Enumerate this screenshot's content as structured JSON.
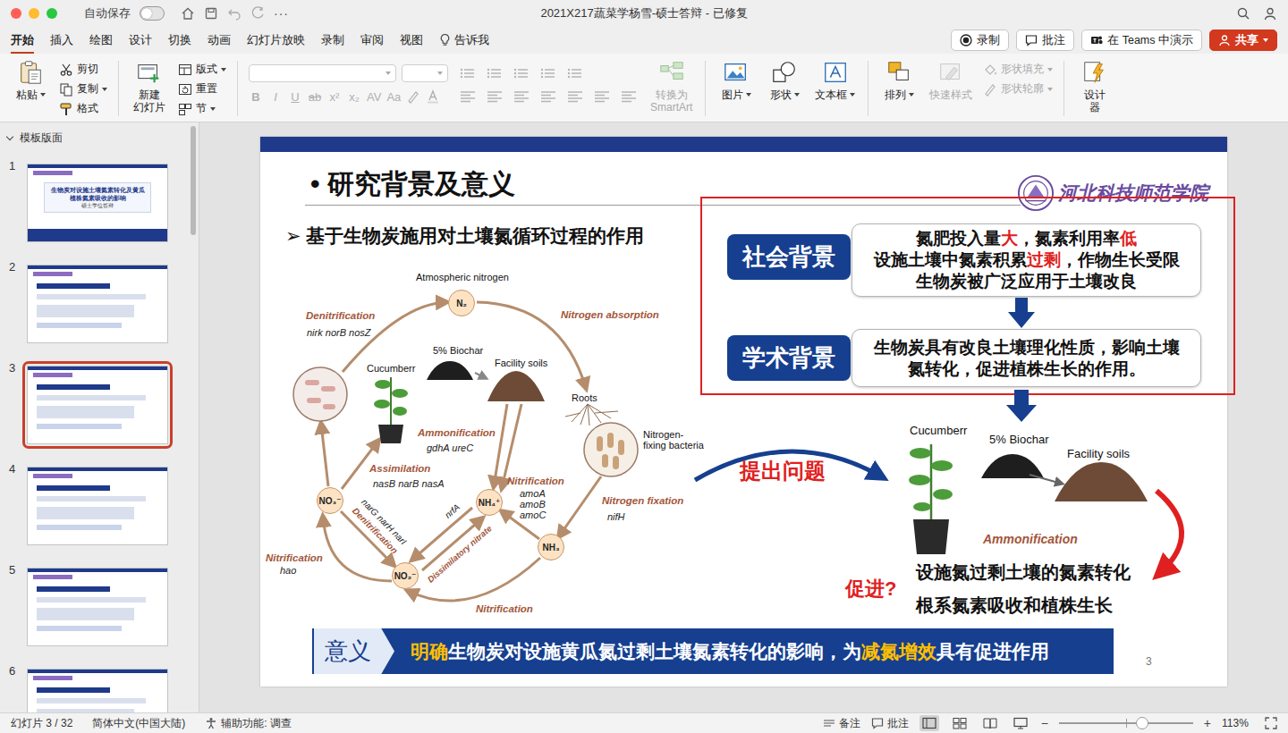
{
  "window": {
    "title": "2021X217蔬菜学杨雪-硕士答辩 - 已修复",
    "autosave": {
      "label": "自动保存",
      "on": false
    },
    "more": "···"
  },
  "tabs": [
    {
      "label": "开始",
      "selected": true
    },
    {
      "label": "插入",
      "selected": false
    },
    {
      "label": "绘图",
      "selected": false
    },
    {
      "label": "设计",
      "selected": false
    },
    {
      "label": "切换",
      "selected": false
    },
    {
      "label": "动画",
      "selected": false
    },
    {
      "label": "幻灯片放映",
      "selected": false
    },
    {
      "label": "录制",
      "selected": false
    },
    {
      "label": "审阅",
      "selected": false
    },
    {
      "label": "视图",
      "selected": false
    }
  ],
  "tell_me": "告诉我",
  "actions": [
    {
      "label": "录制",
      "kind": "record"
    },
    {
      "label": "批注",
      "kind": "comment"
    },
    {
      "label": "在 Teams 中演示",
      "kind": "teams"
    },
    {
      "label": "共享",
      "kind": "share"
    }
  ],
  "ribbon": {
    "paste": "粘贴",
    "clipboard": [
      {
        "label": "剪切",
        "kind": "cut"
      },
      {
        "label": "复制",
        "kind": "copy"
      },
      {
        "label": "格式",
        "kind": "brush"
      }
    ],
    "new_slide": [
      "新建",
      "幻灯片"
    ],
    "slide_tools": [
      {
        "label": "版式",
        "kind": "layout",
        "dropdown": true
      },
      {
        "label": "重置",
        "kind": "reset",
        "dropdown": false
      },
      {
        "label": "节",
        "kind": "section",
        "dropdown": true
      }
    ],
    "format_buttons": [
      {
        "label": "B",
        "disabled": true
      },
      {
        "label": "I",
        "disabled": true
      },
      {
        "label": "U",
        "disabled": true
      },
      {
        "label": "ab",
        "disabled": true
      },
      {
        "label": "x²",
        "disabled": true
      },
      {
        "label": "x₂",
        "disabled": true
      },
      {
        "label": "AV",
        "disabled": true
      },
      {
        "label": "Aa",
        "disabled": true
      }
    ],
    "smartart": {
      "lines": [
        "转换为",
        "SmartArt"
      ],
      "disabled": true
    },
    "insert": [
      {
        "label": "图片",
        "kind": "picture"
      },
      {
        "label": "形状",
        "kind": "shape"
      },
      {
        "label": "文本框",
        "kind": "textbox"
      }
    ],
    "arrange": [
      {
        "label": "排列",
        "kind": "arrange",
        "disabled": false
      },
      {
        "label": "快速样式",
        "kind": "styles",
        "disabled": true
      }
    ],
    "shape_format": [
      {
        "label": "形状填充",
        "kind": "fill",
        "disabled": true
      },
      {
        "label": "形状轮廓",
        "kind": "outline",
        "disabled": true
      }
    ],
    "designer": [
      "设计",
      "器"
    ]
  },
  "sidebar": {
    "header": "模板版面",
    "expanded": true,
    "slides": [
      {
        "number": "1",
        "selected": false,
        "title": "生物炭对设施土壤氮素转化及黄瓜植株氮素吸收的影响",
        "subtitle": "硕士学位答辩"
      },
      {
        "number": "2",
        "selected": false
      },
      {
        "number": "3",
        "selected": true
      },
      {
        "number": "4",
        "selected": false
      },
      {
        "number": "5",
        "selected": false
      },
      {
        "number": "6",
        "selected": false
      }
    ]
  },
  "slide": {
    "title": "• 研究背景及意义",
    "logo": "河北科技师范学院",
    "subtitle": "➢ 基于生物炭施用对土壤氮循环过程的作用",
    "diagram": {
      "nodes": [
        {
          "label": "N₂"
        },
        {
          "label": "NO₃⁻"
        },
        {
          "label": "NH₄⁺"
        },
        {
          "label": "NH₃"
        },
        {
          "label": "NO₂⁻"
        }
      ],
      "labels": [
        {
          "text": "Atmospheric nitrogen",
          "kind": "caption"
        },
        {
          "text": "Denitrification",
          "kind": "process"
        },
        {
          "text": "nirk norB nosZ",
          "kind": "gene"
        },
        {
          "text": "Cucumberr",
          "kind": "caption"
        },
        {
          "text": "5% Biochar",
          "kind": "caption"
        },
        {
          "text": "Facility soils",
          "kind": "caption"
        },
        {
          "text": "Nitrogen absorption",
          "kind": "process"
        },
        {
          "text": "Roots",
          "kind": "caption"
        },
        {
          "text": "Nitrogen-fixing bacteria",
          "kind": "caption"
        },
        {
          "text": "Ammonification",
          "kind": "process"
        },
        {
          "text": "gdhA ureC",
          "kind": "gene"
        },
        {
          "text": "Assimilation",
          "kind": "process"
        },
        {
          "text": "nasB narB nasA",
          "kind": "gene"
        },
        {
          "text": "narG narH narI",
          "kind": "gene"
        },
        {
          "text": "Denitrification",
          "kind": "process"
        },
        {
          "text": "nrfA",
          "kind": "gene"
        },
        {
          "text": "Dissimilatory nitrate",
          "kind": "process"
        },
        {
          "text": "amoA amoB amoC",
          "kind": "gene"
        },
        {
          "text": "Nitrification",
          "kind": "process"
        },
        {
          "text": "Nitrogen fixation",
          "kind": "process"
        },
        {
          "text": "nifH",
          "kind": "gene"
        },
        {
          "text": "Nitrification",
          "kind": "process"
        },
        {
          "text": "hao",
          "kind": "gene"
        },
        {
          "text": "Nitrification",
          "kind": "process"
        }
      ]
    },
    "social": {
      "label": "社会背景",
      "lines": [
        [
          {
            "text": "氮肥投入量",
            "em": false
          },
          {
            "text": "大",
            "em": true
          },
          {
            "text": "，氮素利用率",
            "em": false
          },
          {
            "text": "低",
            "em": true
          }
        ],
        [
          {
            "text": "设施土壤中氮素积累",
            "em": false
          },
          {
            "text": "过剩",
            "em": true
          },
          {
            "text": "，作物生长受限",
            "em": false
          }
        ],
        [
          {
            "text": "生物炭被广泛应用于土壤改良",
            "em": false
          }
        ]
      ]
    },
    "academic": {
      "label": "学术背景",
      "lines": [
        [
          {
            "text": "生物炭具有改良土壤理化性质，影响土壤",
            "em": false
          }
        ],
        [
          {
            "text": "氮转化，促进植株生长的作用。",
            "em": false
          }
        ]
      ]
    },
    "question": "提出问题",
    "figure": [
      {
        "text": "Cucumberr",
        "kind": "caption"
      },
      {
        "text": "5% Biochar",
        "kind": "caption"
      },
      {
        "text": "Facility soils",
        "kind": "caption"
      },
      {
        "text": "Ammonification",
        "kind": "process"
      }
    ],
    "outcomes": [
      "设施氮过剩土壤的氮素转化",
      "根系氮素吸收和植株生长"
    ],
    "promote": "促进?",
    "meaning": {
      "label": "意义",
      "segments": [
        {
          "text": "明确",
          "em": true
        },
        {
          "text": "生物炭对设施黄瓜氮过剩土壤氮素转化的影响，为",
          "em": false
        },
        {
          "text": "减氮增效",
          "em": true
        },
        {
          "text": "具有促进作用",
          "em": false
        }
      ]
    },
    "page": "3"
  },
  "status_bar": {
    "slide": "幻灯片 3 / 32",
    "language": "简体中文(中国大陆)",
    "accessibility": "辅助功能: 调查",
    "notes": "备注",
    "comments": "批注",
    "views": [
      {
        "kind": "normal",
        "selected": true
      },
      {
        "kind": "sorter",
        "selected": false
      },
      {
        "kind": "reading",
        "selected": false
      },
      {
        "kind": "show",
        "selected": false
      }
    ],
    "zoom_minus": "−",
    "zoom_plus": "+",
    "zoom_level": 0.62,
    "zoom": "113%"
  }
}
